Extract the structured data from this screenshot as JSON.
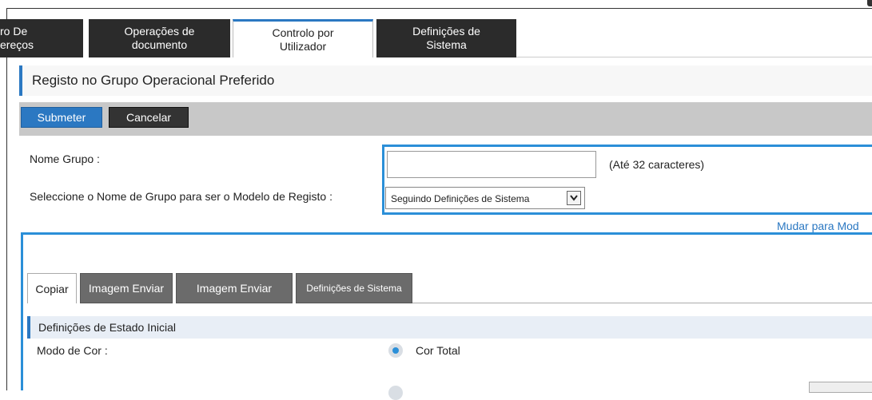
{
  "tabs": [
    {
      "line1": "ro De",
      "line2": "ereços"
    },
    {
      "line1": "Operações de",
      "line2": "documento"
    },
    {
      "line1": "Controlo por",
      "line2": "Utilizador"
    },
    {
      "line1": "Definições de",
      "line2": "Sistema"
    }
  ],
  "active_tab_index": 2,
  "page": {
    "title": "Registo no Grupo Operacional Preferido"
  },
  "actions": {
    "submit": "Submeter",
    "cancel": "Cancelar"
  },
  "form": {
    "group_name_label": "Nome Grupo :",
    "group_name_value": "",
    "group_name_hint": "(Até 32 caracteres)",
    "template_label": "Seleccione o Nome de Grupo para ser o Modelo de Registo :",
    "template_selected": "Seguindo Definições de Sistema"
  },
  "switch_link": "Mudar para Mod",
  "subtabs": [
    "Copiar",
    "Imagem Enviar",
    "Imagem Enviar",
    "Definições de Sistema"
  ],
  "active_subtab_index": 0,
  "section": {
    "title": "Definições de Estado Inicial"
  },
  "color_mode": {
    "label": "Modo de Cor :",
    "selected_option": "Cor Total"
  },
  "colors": {
    "accent": "#2b78c2",
    "highlight_border": "#2b8fd8",
    "tab_dark": "#2b2b2b"
  }
}
